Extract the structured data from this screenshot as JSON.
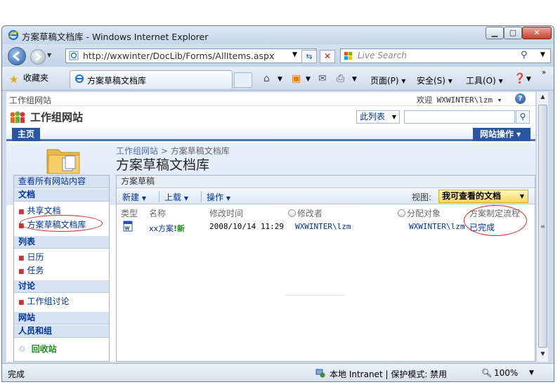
{
  "browser": {
    "title": "方案草稿文档库 - Windows Internet Explorer",
    "address": "http://wxwinter/DocLib/Forms/AllItems.aspx",
    "search_placeholder": "Live Search",
    "favorites_label": "收藏夹",
    "tab_label": "方案草稿文档库",
    "commands": {
      "page": "页面(P)",
      "safety": "安全(S)",
      "tools": "工具(O)"
    },
    "status_text": "完成",
    "zone_text": "本地 Intranet | 保护模式: 禁用",
    "zoom_text": "100%"
  },
  "site": {
    "small_title": "工作组网站",
    "welcome": "欢迎 WXWINTER\\lzm ▾",
    "title": "工作组网站",
    "search_scope": "此列表",
    "home_tab": "主页",
    "site_actions": "网站操作 ▾",
    "breadcrumb_root": "工作组网站",
    "breadcrumb_sep": " > ",
    "breadcrumb_current": "方案草稿文档库",
    "page_title": "方案草稿文档库"
  },
  "quicklaunch": {
    "view_all": "查看所有网站内容",
    "documents_head": "文档",
    "documents": [
      "共享文档",
      "方案草稿文档库"
    ],
    "lists_head": "列表",
    "lists": [
      "日历",
      "任务"
    ],
    "discussions_head": "讨论",
    "discussions": [
      "工作组讨论"
    ],
    "sites_head": "网站",
    "people_head": "人员和组",
    "recycle_bin": "回收站"
  },
  "library": {
    "webpart_title": "方案草稿",
    "toolbar": {
      "new": "新建",
      "upload": "上载",
      "actions": "操作",
      "view_label": "视图:",
      "view_value": "我可查看的文档"
    },
    "columns": [
      "类型",
      "名称",
      "修改时间",
      "修改者",
      "分配对象",
      "方案制定流程"
    ],
    "rows": [
      {
        "name": "xx方案",
        "new_flag": "!新",
        "modified": "2008/10/14 11:29",
        "modified_by": "WXWINTER\\lzm",
        "assigned_to": "WXWINTER\\lzm",
        "workflow_status": "已完成"
      }
    ]
  },
  "colors": {
    "accent": "#2a54a4",
    "link": "#003399",
    "annotation": "#dd2222"
  }
}
